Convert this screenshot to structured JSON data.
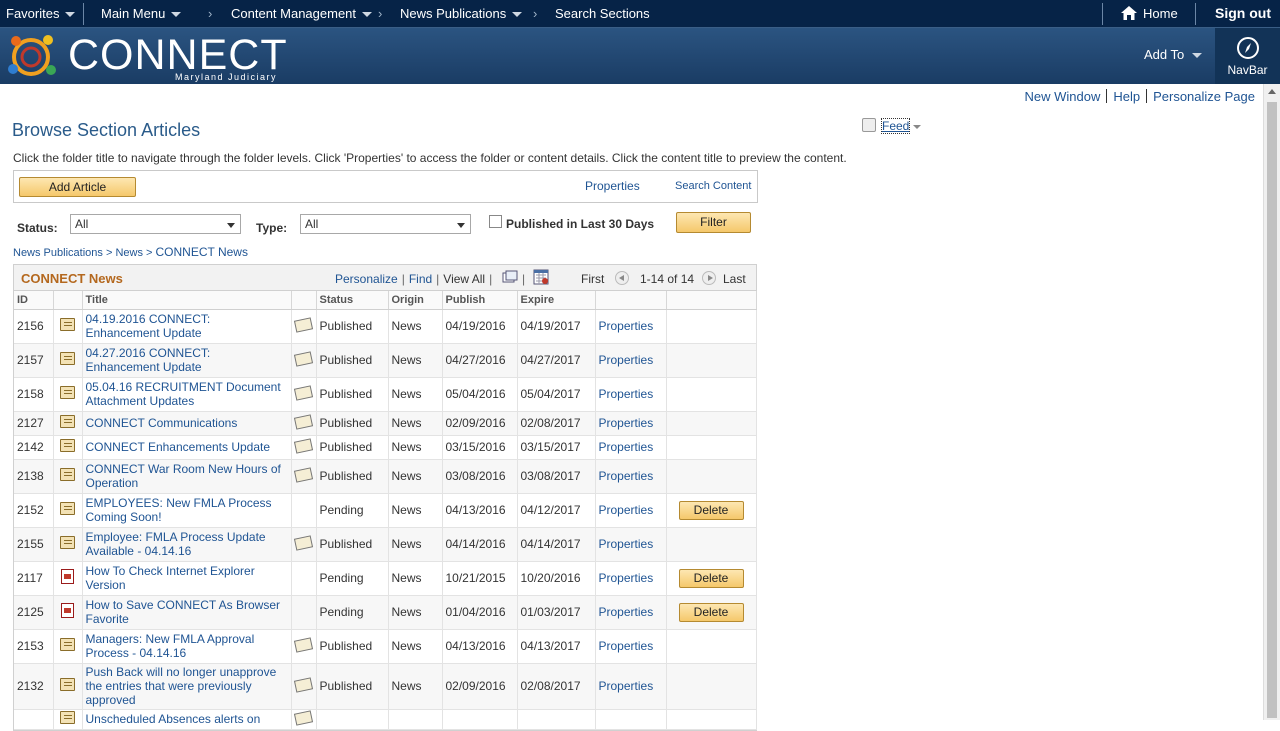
{
  "topnav": {
    "favorites": "Favorites",
    "main_menu": "Main Menu",
    "crumbs": [
      "Content Management",
      "News Publications",
      "Search Sections"
    ],
    "home": "Home",
    "signout": "Sign out"
  },
  "banner": {
    "logo": "CONNECT",
    "logo_sub": "Maryland Judiciary",
    "add_to": "Add To",
    "navbar": "NavBar"
  },
  "utils": {
    "new_window": "New Window",
    "help": "Help",
    "personalize": "Personalize Page"
  },
  "page": {
    "title": "Browse Section Articles",
    "feed": "Feed",
    "instructions": "Click the folder title to navigate through the folder levels.  Click 'Properties' to access the folder or content details.  Click the content title to preview the content."
  },
  "actions": {
    "add_article": "Add Article",
    "properties": "Properties",
    "search_content": "Search Content"
  },
  "filter": {
    "status_label": "Status:",
    "status_value": "All",
    "type_label": "Type:",
    "type_value": "All",
    "published_30": "Published in Last 30 Days",
    "filter_btn": "Filter"
  },
  "breadcrumb": {
    "a": "News Publications",
    "sep": ">",
    "b": "News",
    "c": "CONNECT News"
  },
  "grid": {
    "title": "CONNECT News",
    "personalize": "Personalize",
    "find": "Find",
    "view_all": "View All",
    "first": "First",
    "range": "1-14 of 14",
    "last": "Last",
    "columns": [
      "ID",
      "",
      "Title",
      "",
      "Status",
      "Origin",
      "Publish",
      "Expire",
      "",
      ""
    ],
    "rows": [
      {
        "id": "2156",
        "icon": "doc",
        "title": "04.19.2016 CONNECT: Enhancement Update",
        "pub_icon": true,
        "status": "Published",
        "origin": "News",
        "publish": "04/19/2016",
        "expire": "04/19/2017",
        "props": "Properties",
        "delete": ""
      },
      {
        "id": "2157",
        "icon": "doc",
        "title": "04.27.2016 CONNECT: Enhancement Update",
        "pub_icon": true,
        "status": "Published",
        "origin": "News",
        "publish": "04/27/2016",
        "expire": "04/27/2017",
        "props": "Properties",
        "delete": ""
      },
      {
        "id": "2158",
        "icon": "doc",
        "title": "05.04.16 RECRUITMENT Document Attachment Updates",
        "pub_icon": true,
        "status": "Published",
        "origin": "News",
        "publish": "05/04/2016",
        "expire": "05/04/2017",
        "props": "Properties",
        "delete": ""
      },
      {
        "id": "2127",
        "icon": "doc",
        "title": "CONNECT Communications",
        "pub_icon": true,
        "status": "Published",
        "origin": "News",
        "publish": "02/09/2016",
        "expire": "02/08/2017",
        "props": "Properties",
        "delete": ""
      },
      {
        "id": "2142",
        "icon": "doc",
        "title": "CONNECT Enhancements Update",
        "pub_icon": true,
        "status": "Published",
        "origin": "News",
        "publish": "03/15/2016",
        "expire": "03/15/2017",
        "props": "Properties",
        "delete": ""
      },
      {
        "id": "2138",
        "icon": "doc",
        "title": "CONNECT War Room New Hours of Operation",
        "pub_icon": true,
        "status": "Published",
        "origin": "News",
        "publish": "03/08/2016",
        "expire": "03/08/2017",
        "props": "Properties",
        "delete": ""
      },
      {
        "id": "2152",
        "icon": "doc",
        "title": "EMPLOYEES: New FMLA Process Coming Soon!",
        "pub_icon": false,
        "status": "Pending",
        "origin": "News",
        "publish": "04/13/2016",
        "expire": "04/12/2017",
        "props": "Properties",
        "delete": "Delete"
      },
      {
        "id": "2155",
        "icon": "doc",
        "title": "Employee: FMLA Process Update Available - 04.14.16",
        "pub_icon": true,
        "status": "Published",
        "origin": "News",
        "publish": "04/14/2016",
        "expire": "04/14/2017",
        "props": "Properties",
        "delete": ""
      },
      {
        "id": "2117",
        "icon": "pdf",
        "title": "How To Check Internet Explorer Version",
        "pub_icon": false,
        "status": "Pending",
        "origin": "News",
        "publish": "10/21/2015",
        "expire": "10/20/2016",
        "props": "Properties",
        "delete": "Delete"
      },
      {
        "id": "2125",
        "icon": "pdf",
        "title": "How to Save CONNECT As Browser Favorite",
        "pub_icon": false,
        "status": "Pending",
        "origin": "News",
        "publish": "01/04/2016",
        "expire": "01/03/2017",
        "props": "Properties",
        "delete": "Delete"
      },
      {
        "id": "2153",
        "icon": "doc",
        "title": "Managers: New FMLA Approval Process - 04.14.16",
        "pub_icon": true,
        "status": "Published",
        "origin": "News",
        "publish": "04/13/2016",
        "expire": "04/13/2017",
        "props": "Properties",
        "delete": ""
      },
      {
        "id": "2132",
        "icon": "doc",
        "title": "Push Back will no longer unapprove the entries that were previously approved",
        "pub_icon": true,
        "status": "Published",
        "origin": "News",
        "publish": "02/09/2016",
        "expire": "02/08/2017",
        "props": "Properties",
        "delete": ""
      },
      {
        "id": "",
        "icon": "doc",
        "title": "Unscheduled Absences alerts on",
        "pub_icon": true,
        "status": "",
        "origin": "",
        "publish": "",
        "expire": "",
        "props": "",
        "delete": ""
      }
    ]
  }
}
